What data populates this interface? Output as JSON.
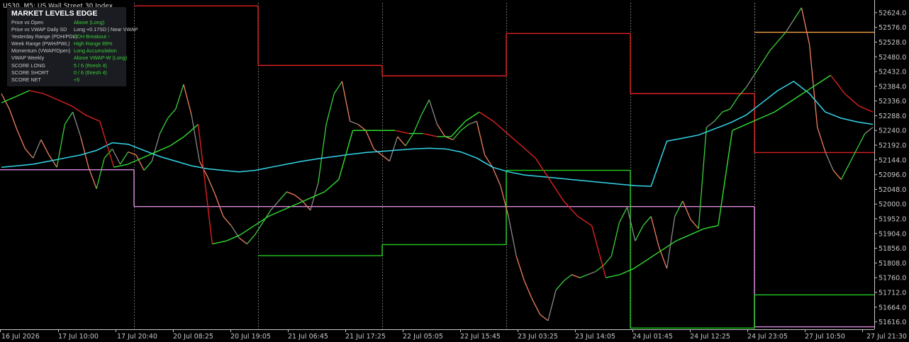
{
  "window": {
    "title": "US30, M5:  US Wall Street 30 Index"
  },
  "panel": {
    "title": "MARKET LEVELS EDGE",
    "rows": [
      {
        "label": "Price vs Open",
        "value": "Above (Long)"
      },
      {
        "label": "Price vs VWAP Daily SD",
        "value": "Long +0.17SD | Near VWAP"
      },
      {
        "label": "Yesterday Range (PDH/PDL)",
        "value": "PDH Breakout ↑"
      },
      {
        "label": "Week Range (PWH/PWL)",
        "value": "High Range 89%"
      },
      {
        "label": "Momentum (VWAP/Open)",
        "value": "Long Accumulation"
      },
      {
        "label": "VWAP Weekly",
        "value": "Above VWAP-W (Long)"
      },
      {
        "label": "SCORE LONG",
        "value": "5 / 6  (thresh 4)"
      },
      {
        "label": "SCORE SHORT",
        "value": "0 / 6  (thresh 4)"
      },
      {
        "label": "SCORE NET",
        "value": "+5"
      }
    ]
  },
  "colors": {
    "background": "#000000",
    "price_up": "#3ccf3c",
    "price_down": "#f08060",
    "price_neutral": "#8a8a8a",
    "vwap_weekly": "#33d6e8",
    "vwap_daily_up": "#33dd33",
    "vwap_daily_down": "#dd2222",
    "pdh": "#dd2020",
    "pdl": "#22cc22",
    "week_open": "#dd88dd",
    "high_line": "#f0a040"
  },
  "chart_data": {
    "type": "line",
    "title": "US30, M5:  US Wall Street 30 Index",
    "ylim": [
      51592,
      52656
    ],
    "price_ticks": [
      "52624.0",
      "52576.0",
      "52528.0",
      "52480.0",
      "52432.0",
      "52384.0",
      "52336.0",
      "52288.0",
      "52240.0",
      "52192.0",
      "52144.0",
      "52096.0",
      "52048.0",
      "52000.0",
      "51952.0",
      "51904.0",
      "51856.0",
      "51808.0",
      "51760.0",
      "51712.0",
      "51664.0",
      "51616.0"
    ],
    "time_ticks": [
      "16 Jul 2026",
      "17 Jul 10:00",
      "17 Jul 20:40",
      "20 Jul 08:25",
      "20 Jul 19:05",
      "21 Jul 06:45",
      "21 Jul 17:25",
      "22 Jul 05:05",
      "22 Jul 15:45",
      "23 Jul 03:25",
      "23 Jul 14:05",
      "24 Jul 01:45",
      "24 Jul 12:25",
      "24 Jul 23:05",
      "27 Jul 10:50",
      "27 Jul 21:30"
    ],
    "session_breaks": [
      "17 Jul 20:40",
      "20 Jul 19:05",
      "21 Jul 17:25",
      "22 Jul 15:45",
      "23 Jul 14:05",
      "24 Jul 12:25",
      "24 Jul 23:05"
    ],
    "pdh_levels": [
      {
        "from": "17 Jul 20:40",
        "to": "20 Jul 19:05",
        "y": 52646
      },
      {
        "from": "20 Jul 19:05",
        "to": "21 Jul 17:25",
        "y": 52452
      },
      {
        "from": "21 Jul 17:25",
        "to": "22 Jul 15:45",
        "y": 52418
      },
      {
        "from": "22 Jul 15:45",
        "to": "23 Jul 14:05",
        "y": 52556
      },
      {
        "from": "23 Jul 14:05",
        "to": "24 Jul 23:05",
        "y": 52360
      },
      {
        "from": "24 Jul 23:05",
        "to": "27 Jul 21:30",
        "y": 52168
      }
    ],
    "pdl_levels": [
      {
        "from": "20 Jul 19:05",
        "to": "21 Jul 17:25",
        "y": 51832
      },
      {
        "from": "21 Jul 17:25",
        "to": "22 Jul 15:45",
        "y": 51868
      },
      {
        "from": "22 Jul 15:45",
        "to": "23 Jul 14:05",
        "y": 52110
      },
      {
        "from": "23 Jul 14:05",
        "to": "24 Jul 23:05",
        "y": 51596
      },
      {
        "from": "24 Jul 23:05",
        "to": "27 Jul 21:30",
        "y": 51704
      }
    ],
    "week_open_levels": [
      {
        "from": "16 Jul 2026",
        "to": "17 Jul 20:40",
        "y": 52112
      },
      {
        "from": "17 Jul 20:40",
        "to": "24 Jul 23:05",
        "y": 51992
      },
      {
        "from": "24 Jul 23:05",
        "to": "27 Jul 21:30",
        "y": 51600
      }
    ],
    "high_level": {
      "from": "24 Jul 23:05",
      "to": "27 Jul 21:30",
      "y": 52560
    },
    "price": [
      52360,
      52310,
      52240,
      52180,
      52150,
      52210,
      52160,
      52120,
      52260,
      52300,
      52220,
      52120,
      52050,
      52150,
      52180,
      52130,
      52170,
      52160,
      52110,
      52140,
      52230,
      52280,
      52310,
      52390,
      52290,
      52140,
      52090,
      52030,
      51960,
      51930,
      51890,
      51870,
      51900,
      51940,
      51980,
      52010,
      52040,
      52030,
      52010,
      51980,
      52070,
      52260,
      52360,
      52400,
      52270,
      52260,
      52240,
      52180,
      52160,
      52140,
      52220,
      52190,
      52230,
      52290,
      52340,
      52260,
      52220,
      52210,
      52240,
      52260,
      52270,
      52160,
      52120,
      52060,
      51960,
      51830,
      51750,
      51690,
      51640,
      51620,
      51720,
      51750,
      51770,
      51760,
      51770,
      51780,
      51800,
      51830,
      51940,
      51990,
      51880,
      51930,
      51960,
      51860,
      51790,
      51960,
      52010,
      51950,
      51920,
      52250,
      52270,
      52300,
      52310,
      52350,
      52380,
      52420,
      52460,
      52500,
      52530,
      52560,
      52600,
      52640,
      52520,
      52250,
      52170,
      52110,
      52080,
      52130,
      52180,
      52230,
      52250
    ],
    "vwap_weekly": [
      52120,
      52125,
      52130,
      52140,
      52150,
      52160,
      52175,
      52200,
      52195,
      52175,
      52155,
      52140,
      52125,
      52115,
      52110,
      52105,
      52110,
      52120,
      52130,
      52140,
      52148,
      52155,
      52162,
      52168,
      52172,
      52176,
      52180,
      52182,
      52180,
      52170,
      52150,
      52120,
      52105,
      52095,
      52090,
      52085,
      52080,
      52075,
      52070,
      52065,
      52060,
      52058,
      52205,
      52215,
      52225,
      52245,
      52265,
      52290,
      52330,
      52370,
      52400,
      52360,
      52300,
      52280,
      52268,
      52260
    ],
    "vwap_daily": [
      52330,
      52350,
      52370,
      52360,
      52340,
      52320,
      52290,
      52270,
      52120,
      52130,
      52150,
      52170,
      52190,
      52220,
      52260,
      51870,
      51880,
      51900,
      51930,
      51960,
      51980,
      52000,
      52020,
      52040,
      52080,
      52240,
      52240,
      52240,
      52240,
      52230,
      52230,
      52220,
      52220,
      52270,
      52300,
      52270,
      52230,
      52190,
      52150,
      52080,
      52010,
      51960,
      51930,
      51760,
      51770,
      51790,
      51820,
      51850,
      51880,
      51900,
      51920,
      51930,
      52240,
      52260,
      52280,
      52300,
      52330,
      52360,
      52390,
      52420,
      52360,
      52320,
      52300
    ]
  }
}
